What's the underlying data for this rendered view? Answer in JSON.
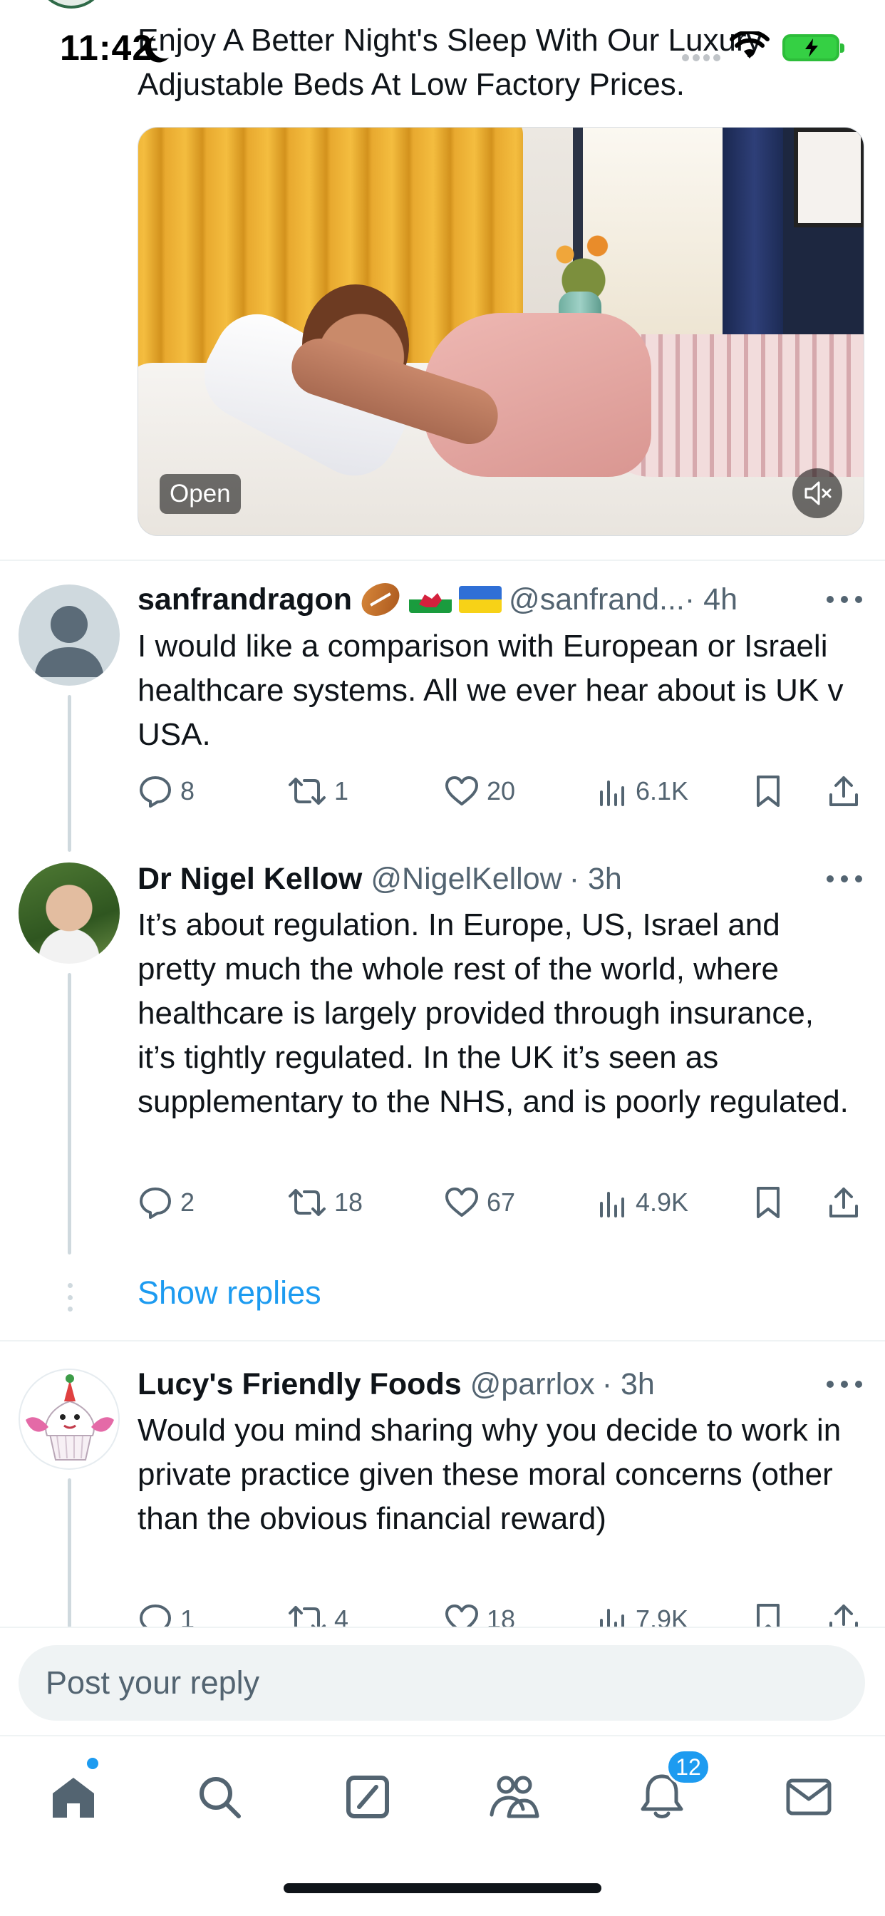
{
  "status_bar": {
    "time": "11:42"
  },
  "ad": {
    "text": "Enjoy A Better Night's Sleep With Our Luxury Adjustable Beds At Low Factory Prices.",
    "open_label": "Open"
  },
  "replies": [
    {
      "name": "sanfrandragon",
      "handle": "@sanfrand...",
      "time": "· 4h",
      "text": "I would like a comparison with European or Israeli healthcare systems.  All we ever hear about is UK v USA.",
      "replies": "8",
      "reposts": "1",
      "likes": "20",
      "views": "6.1K"
    },
    {
      "name": "Dr Nigel Kellow",
      "handle": "@NigelKellow",
      "time": "· 3h",
      "text": "It’s about regulation. In Europe, US, Israel and pretty much the whole rest of the world, where healthcare is largely provided through insurance, it’s tightly regulated. In the UK it’s seen as supplementary to the NHS, and is poorly regulated.",
      "replies": "2",
      "reposts": "18",
      "likes": "67",
      "views": "4.9K"
    },
    {
      "name": "Lucy's Friendly Foods",
      "handle": "@parrlox",
      "time": "· 3h",
      "text": "Would you mind sharing why you decide to work in private practice given these moral concerns (other than the obvious financial reward)",
      "replies": "1",
      "reposts": "4",
      "likes": "18",
      "views": "7.9K"
    }
  ],
  "show_replies_label": "Show replies",
  "reply_bar": {
    "placeholder": "Post your reply"
  },
  "tab_bar": {
    "notifications_count": "12"
  },
  "colors": {
    "accent": "#1d9bf0",
    "text": "#0f1419",
    "muted": "#536471"
  }
}
